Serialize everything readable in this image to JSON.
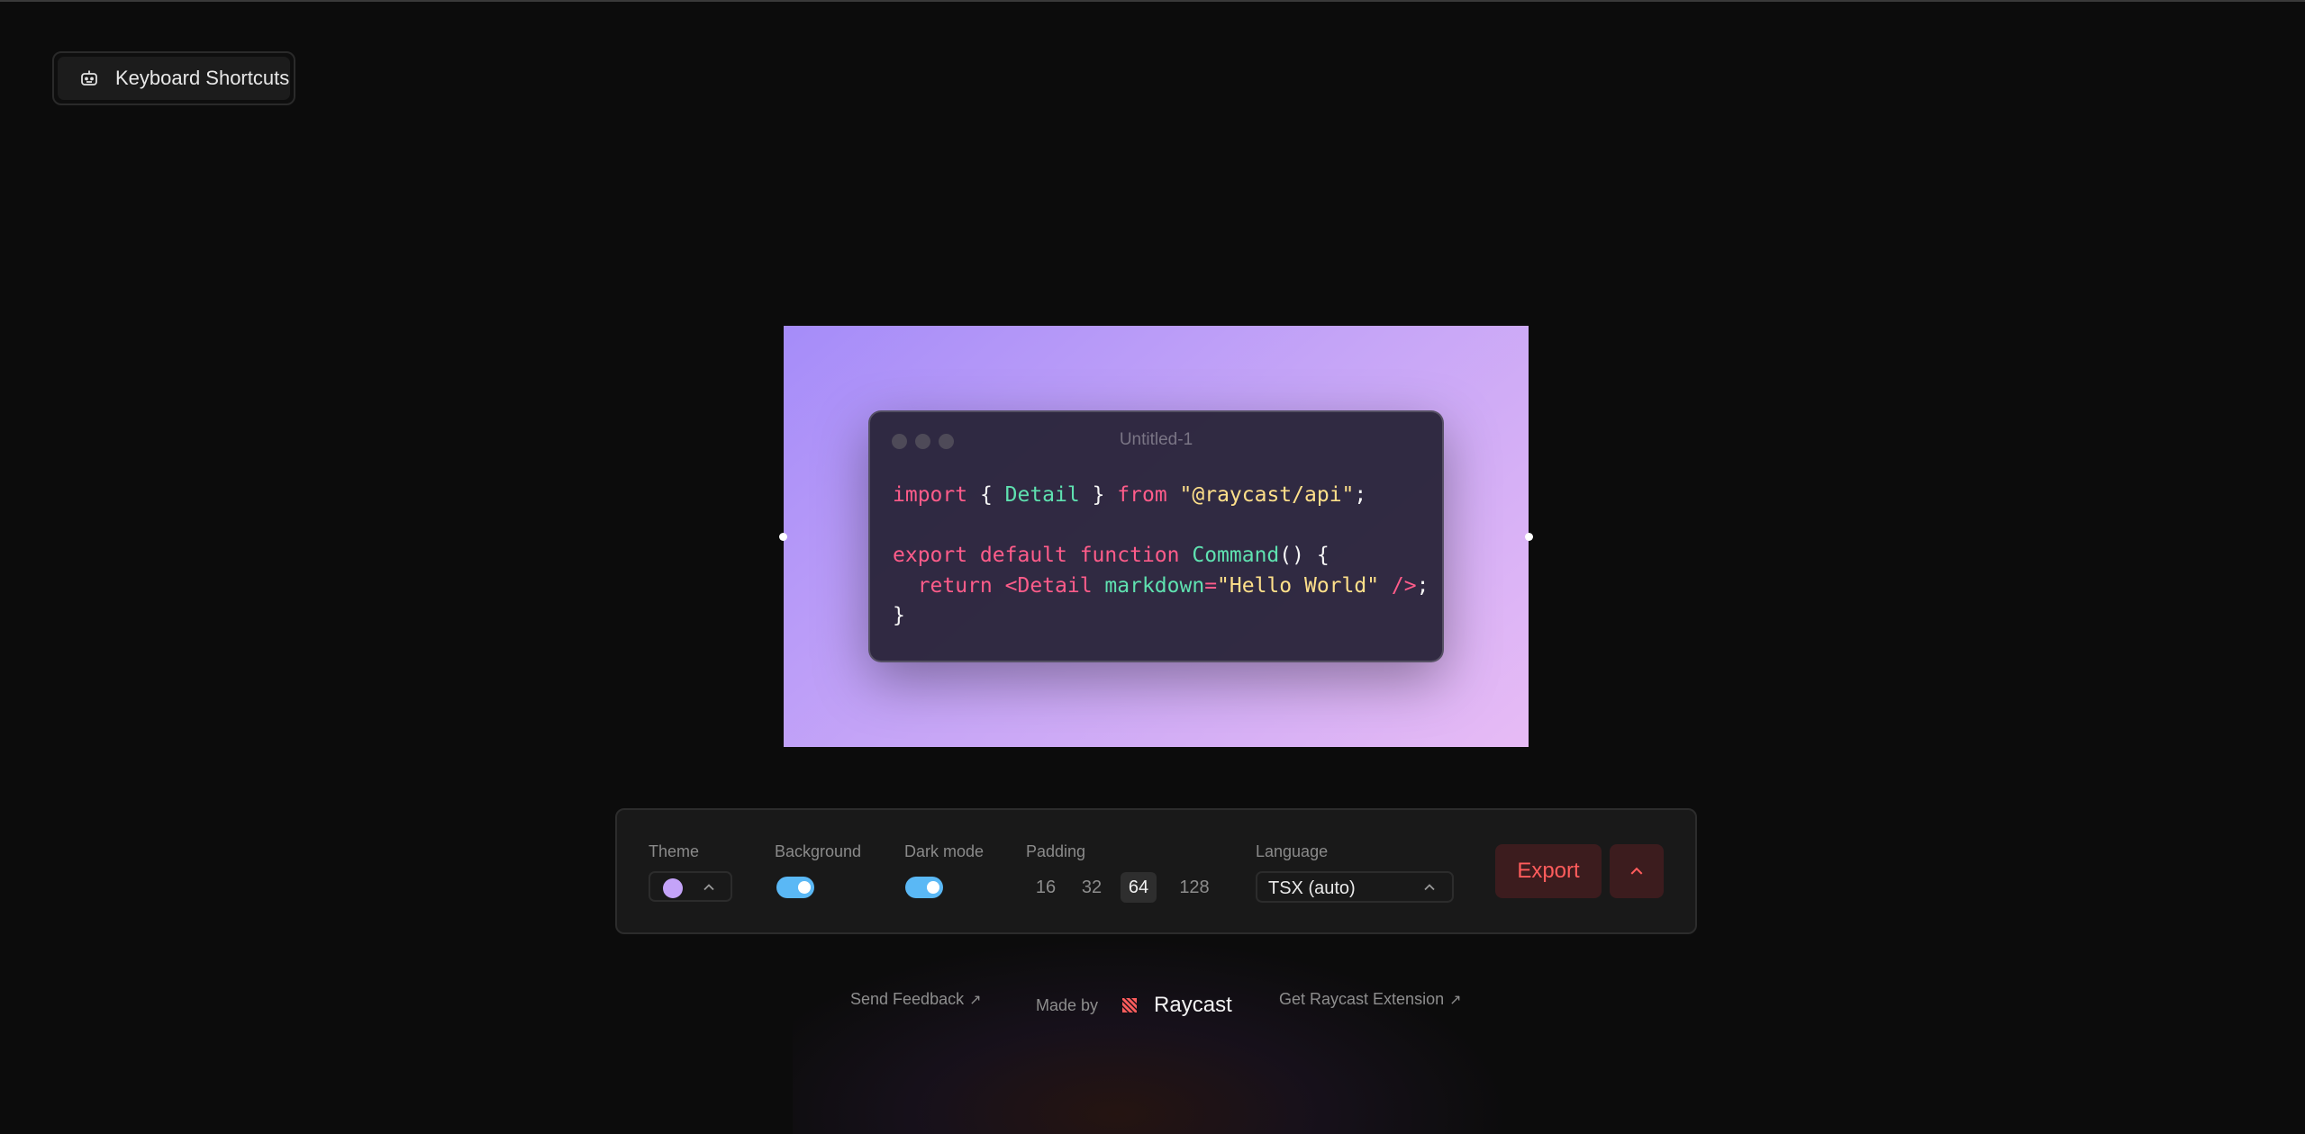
{
  "header": {
    "shortcuts_label": "Keyboard Shortcuts"
  },
  "editor": {
    "window_title": "Untitled-1",
    "code_lines": [
      [
        {
          "t": "import",
          "c": "kw"
        },
        {
          "t": " { ",
          "c": "pl"
        },
        {
          "t": "Detail",
          "c": "fn"
        },
        {
          "t": " } ",
          "c": "pl"
        },
        {
          "t": "from",
          "c": "kw"
        },
        {
          "t": " ",
          "c": "pl"
        },
        {
          "t": "\"@raycast/api\"",
          "c": "str"
        },
        {
          "t": ";",
          "c": "pl"
        }
      ],
      [],
      [
        {
          "t": "export default function ",
          "c": "kw"
        },
        {
          "t": "Command",
          "c": "fn"
        },
        {
          "t": "() {",
          "c": "pl"
        }
      ],
      [
        {
          "t": "  return ",
          "c": "kw"
        },
        {
          "t": "<Detail ",
          "c": "kw"
        },
        {
          "t": "markdown",
          "c": "fn"
        },
        {
          "t": "=",
          "c": "kw"
        },
        {
          "t": "\"Hello World\"",
          "c": "str"
        },
        {
          "t": " />",
          "c": "kw"
        },
        {
          "t": ";",
          "c": "pl"
        }
      ],
      [
        {
          "t": "}",
          "c": "pl"
        }
      ]
    ]
  },
  "toolbar": {
    "theme_label": "Theme",
    "theme_color": "#c4a3f8",
    "background_label": "Background",
    "background_on": true,
    "dark_mode_label": "Dark mode",
    "dark_mode_on": true,
    "padding_label": "Padding",
    "padding_options": [
      "16",
      "32",
      "64",
      "128"
    ],
    "padding_selected": "64",
    "language_label": "Language",
    "language_value": "TSX (auto)",
    "export_label": "Export",
    "more_icon": "chevron-up-icon"
  },
  "footer": {
    "send_feedback": "Send Feedback",
    "made_by": "Made by",
    "brand": "Raycast",
    "get_extension": "Get Raycast Extension",
    "arrow": "↗"
  },
  "colors": {
    "accent_export": "#ff5c5c",
    "toggle_on": "#5ab8f5",
    "keyword": "#ff5c8a",
    "function": "#5fe1b0",
    "string": "#ffe08a"
  }
}
